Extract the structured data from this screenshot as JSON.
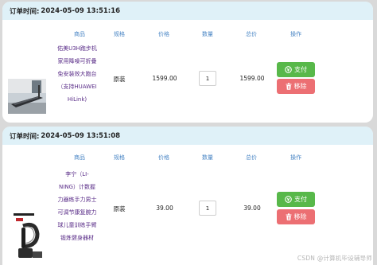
{
  "columns": {
    "product": "商品",
    "spec": "规格",
    "price": "价格",
    "quantity": "数量",
    "total": "总价",
    "action": "操作"
  },
  "orders": [
    {
      "time_label": "订单时间:",
      "time_value": "2024-05-09 13:51:16",
      "product_lines": [
        "佑美U3H跑步机",
        "家用降噪可折叠",
        "免安装效大跑台",
        "（支持HUAWEI",
        "HiLink)"
      ],
      "spec": "原装",
      "price": "1599.00",
      "quantity": "1",
      "total": "1599.00",
      "pay_label": "支付",
      "remove_label": "移除"
    },
    {
      "time_label": "订单时间:",
      "time_value": "2024-05-09 13:51:08",
      "product_lines": [
        "李宁（LI-",
        "NING）计数握",
        "力器练手力男士",
        "可调节康复腕力",
        "球儿童训练手臂",
        "锻炼健身器材"
      ],
      "spec": "原装",
      "price": "39.00",
      "quantity": "1",
      "total": "39.00",
      "pay_label": "支付",
      "remove_label": "移除"
    }
  ],
  "watermark": "CSDN @计算机毕设辅导师",
  "icons": {
    "pay": "pay-circle-icon",
    "remove": "trash-icon"
  },
  "colors": {
    "header_bg": "#dff1f8",
    "column_header": "#4a86c5",
    "product_name": "#5a2d88",
    "pay_button": "#58b84a",
    "remove_button": "#ec6f73"
  }
}
